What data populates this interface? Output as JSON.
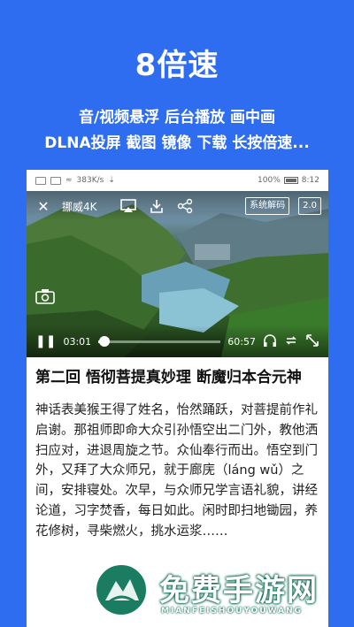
{
  "promo": {
    "title": "8倍速",
    "line1": "音/视频悬浮 后台播放 画中画",
    "line2": "DLNA投屏 截图 镜像 下载 长按倍速..."
  },
  "statusbar": {
    "speed": "383K/s",
    "battery": "100%",
    "time": "8:12"
  },
  "player": {
    "title": "挪威4K",
    "decoder_label": "系统解码",
    "speed_label": "2.0",
    "current_time": "03:01",
    "total_time": "60:57",
    "progress": 0.05
  },
  "article": {
    "title": "第二回 悟彻菩提真妙理 断魔归本合元神",
    "body": "神话表美猴王得了姓名，怡然踊跃，对菩提前作礼启谢。那祖师即命大众引孙悟空出二门外，教他洒扫应对，进退周旋之节。众仙奉行而出。悟空到门外，又拜了大众师兄，就于廊庑（láng wǔ）之间，安排寝处。次早，与众师兄学言语礼貌，讲经论道，习字焚香，每日如此。闲时即扫地锄园，养花修树，寻柴燃火，挑水运浆……"
  },
  "watermark": {
    "text": "免费手游网",
    "sub": "MIANFEISHOUYOUWANG"
  },
  "colors": {
    "background": "#2f6df0",
    "watermark_green": "#1a7d62"
  }
}
